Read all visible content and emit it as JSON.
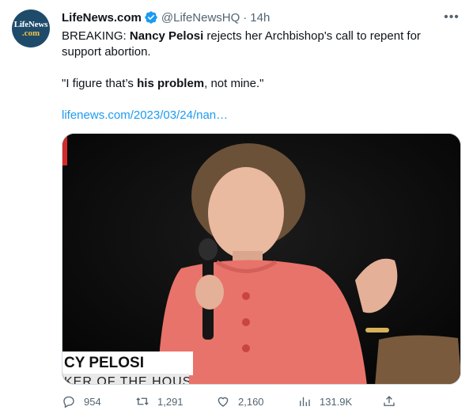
{
  "author": {
    "avatar_line1": "LifeNews",
    "avatar_line2": ".com",
    "name": "LifeNews.com",
    "handle": "@LifeNewsHQ",
    "separator": "·",
    "time": "14h"
  },
  "tweet": {
    "breaking": "BREAKING: ",
    "bold_name": "Nancy Pelosi",
    "line1_rest": " rejects her Archbishop's call to repent for support abortion.",
    "quote_start": "\"I figure that’s ",
    "quote_bold": "his problem",
    "quote_end": ", not mine.\"",
    "link": "lifenews.com/2023/03/24/nan…"
  },
  "media": {
    "chyron_name": "CY PELOSI",
    "chyron_title": "KER OF THE HOUSE"
  },
  "actions": {
    "replies": "954",
    "retweets": "1,291",
    "likes": "2,160",
    "views": "131.9K"
  },
  "icons": [
    "more-icon",
    "verified-icon",
    "reply-icon",
    "retweet-icon",
    "like-icon",
    "views-icon",
    "share-icon"
  ],
  "colors": {
    "link": "#1d9bf0",
    "verified": "#1d9bf0",
    "secondary_text": "#536471",
    "jacket": "#e8736a"
  }
}
